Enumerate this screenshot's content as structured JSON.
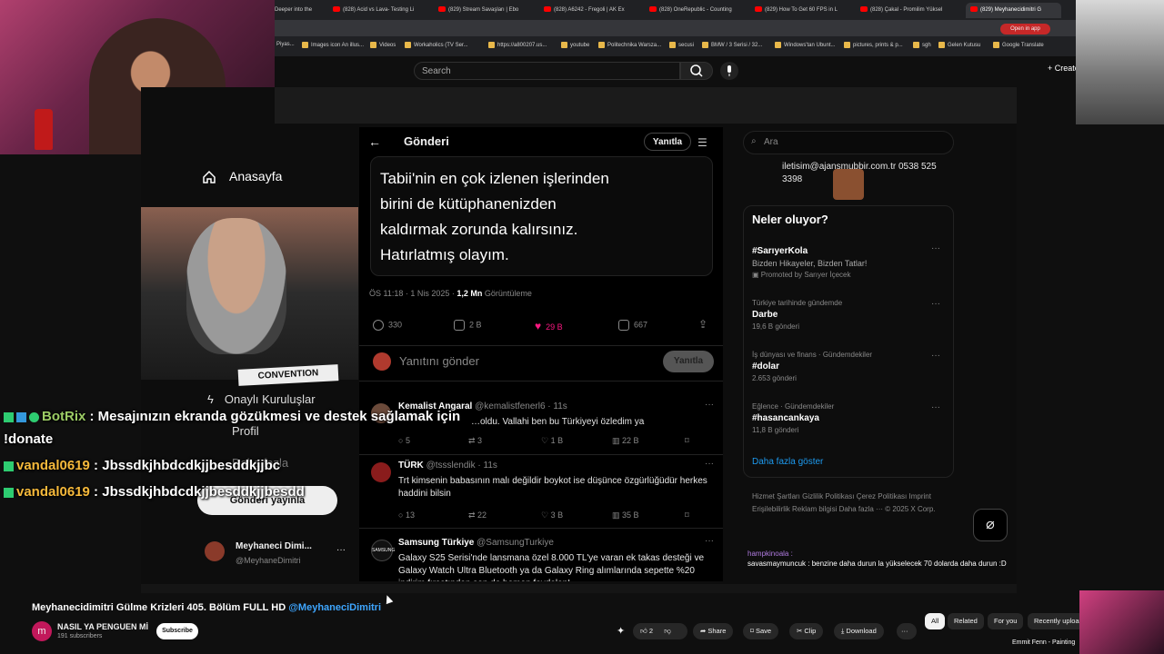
{
  "browser": {
    "tabs": [
      "Deeper into the",
      "(828) Acid vs Lava- Testing Li",
      "(829) Stream Savaşları | Ebo",
      "(828) A6242 - Fregoli | AK Ex",
      "(828) OneRepublic - Counting",
      "(829) How To Get 60 FPS in L",
      "(828) Çakal - Promilim Yüksel",
      "(829) Meyhanecidimitri G"
    ],
    "open_in_app": "Open in app",
    "bookmarks": [
      "Piyas...",
      "Images icon An illus...",
      "Videos",
      "Workaholics (TV Ser...",
      "https://a800207.us...",
      "youtube",
      "Politechnika Warsza...",
      "secusi",
      "BMW / 3 Serisi / 32...",
      "Windows'tan Ubunt...",
      "pictures, prints & p...",
      "sgh",
      "Gelen Kutusu",
      "Google Translate"
    ]
  },
  "youtube": {
    "search_placeholder": "Search",
    "create_label": "Create",
    "video_title": "Meyhanecidimitri Gülme Krizleri 405. Bölüm FULL HD",
    "video_title_link": "@MeyhaneciDimitri",
    "channel_initial": "m",
    "channel_name": "NASIL YA PENGUEN Mİ",
    "subscribers": "191 subscribers",
    "subscribe_label": "Subscribe",
    "likes": "2",
    "share_label": "Share",
    "save_label": "Save",
    "clip_label": "Clip",
    "download_label": "Download",
    "chips": [
      "All",
      "Related",
      "For you",
      "Recently uploa"
    ],
    "next_video": "Emmit Fenn - Painting"
  },
  "stream_sidebar": {
    "home": "Anasayfa",
    "verified_orgs": "Onaylı Kuruluşlar",
    "profile": "Profil",
    "more": "Daha fazla",
    "post_button": "Gönderi yayınla",
    "account_name": "Meyhaneci Dimi...",
    "account_handle": "@MeyhaneDimitri",
    "guest_shirt": "CONVENTION"
  },
  "tweet": {
    "header": "Gönderi",
    "reply_top": "Yanıtla",
    "lines": [
      "Tabii'nin en çok izlenen işlerinden",
      "birini de kütüphanenizden",
      "kaldırmak zorunda kalırsınız.",
      "Hatırlatmış olayım."
    ],
    "time": "ÖS 11:18 · 1 Nis 2025 · ",
    "views": "1,2 Mn",
    "views_label": " Görüntüleme",
    "replies": "330",
    "retweets": "2 B",
    "likes": "29 B",
    "bookmarks": "667",
    "reply_placeholder": "Yanıtını gönder",
    "reply_button": "Yanıtla"
  },
  "replies": [
    {
      "name": "Kemalist Angaral",
      "handle": "@kemalistfenerl6 · 11s",
      "text": "…oldu. Vallahi ben bu Türkiyeyi özledim ya",
      "c": "5",
      "r": "3",
      "l": "1 B",
      "v": "22 B",
      "color": "#6b4a3a"
    },
    {
      "name": "TÜRK",
      "handle": "@tssslendik · 11s",
      "text": "Trt kimsenin babasının malı değildir boykot ise düşünce özgürlüğüdür herkes haddini bilsin",
      "c": "13",
      "r": "22",
      "l": "3 B",
      "v": "35 B",
      "color": "#8a1c1c"
    },
    {
      "name": "Samsung Türkiye",
      "handle": "@SamsungTurkiye",
      "text": "Galaxy S25 Serisi'nde lansmana özel 8.000 TL'ye varan ek takas desteği ve Galaxy Watch Ultra Bluetooth ya da Galaxy Ring alımlarında sepette %20 indirim fırsatından sen de hemen faydalan!",
      "c": "",
      "r": "",
      "l": "",
      "v": "",
      "color": "#111"
    }
  ],
  "x_sidebar": {
    "search_placeholder": "Ara",
    "contact": "iletisim@ajansmubbir.com.tr 0538 525 3398",
    "trends_title": "Neler oluyor?",
    "trends": [
      {
        "category": "",
        "name": "#SarıyerKola",
        "count": "Bizden Hikayeler, Bizden Tatlar!",
        "promo": "Promoted by Sarıyer İçecek"
      },
      {
        "category": "Türkiye tarihinde gündemde",
        "name": "Darbe",
        "count": "19,6 B gönderi",
        "promo": ""
      },
      {
        "category": "İş dünyası ve finans · Gündemdekiler",
        "name": "#dolar",
        "count": "2.653 gönderi",
        "promo": ""
      },
      {
        "category": "Eğlence · Gündemdekiler",
        "name": "#hasancankaya",
        "count": "11,8 B gönderi",
        "promo": ""
      }
    ],
    "show_more": "Daha fazla göster",
    "footer": "Hizmet Şartları   Gizlilik Politikası   Çerez Politikası   Imprint   Erişilebilirlik   Reklam bilgisi   Daha fazla ···   © 2025 X Corp."
  },
  "stream_chat": [
    "hampkinoala :",
    "savasmaymuncuk : benzine daha durun la yükselecek 70 dolarda daha durun :D"
  ],
  "chat_overlay": [
    {
      "user": "BotRix",
      "message": " : Mesajınızın ekranda gözükmesi ve destek sağlamak için"
    },
    {
      "user": "",
      "message": "!donate"
    },
    {
      "user": "vandal0619",
      "message": " : Jbssdkjhbdcdkjjbesddkjjbc"
    },
    {
      "user": "vandal0619",
      "message": " : Jbssdkjhbdcdkjjbesddkjjbesdd"
    }
  ],
  "colors": {
    "like_pink": "#f91880",
    "link_blue": "#1d9bf0",
    "yt_red": "#ff0000"
  }
}
